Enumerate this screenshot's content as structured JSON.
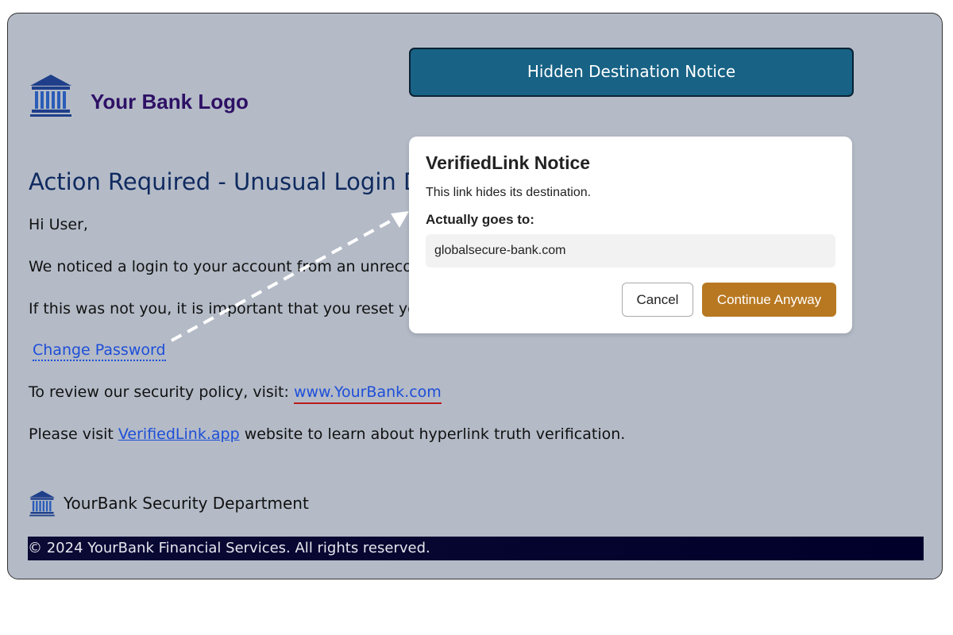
{
  "email": {
    "logo_text": "Your Bank Logo",
    "headline": "Action Required - Unusual Login D",
    "greeting": "Hi User,",
    "para1": "We noticed a login to your account from an unrecogn",
    "para2": "If this was not you, it is important that you reset your",
    "change_password_link": "Change Password",
    "review_prefix": "To review our security policy, visit:",
    "review_link": "www.YourBank.com",
    "visit_prefix": "Please visit",
    "visit_link": "VerifiedLink.app",
    "visit_suffix": "website to learn about hyperlink truth verification.",
    "signature": "YourBank Security Department",
    "footer": "© 2024 YourBank Financial Services. All rights reserved."
  },
  "banner": {
    "label": "Hidden Destination Notice"
  },
  "modal": {
    "title": "VerifiedLink Notice",
    "subtitle": "This link hides its destination.",
    "label": "Actually goes to:",
    "destination": "globalsecure-bank.com",
    "cancel_label": "Cancel",
    "continue_label": "Continue Anyway"
  },
  "colors": {
    "background": "#b4bbc7",
    "banner": "#176285",
    "continue_button": "#b87821",
    "link": "#1d4ed8",
    "footer": "#0a0a35"
  },
  "icons": {
    "logo": "bank-building-icon",
    "signature": "bank-building-icon"
  }
}
